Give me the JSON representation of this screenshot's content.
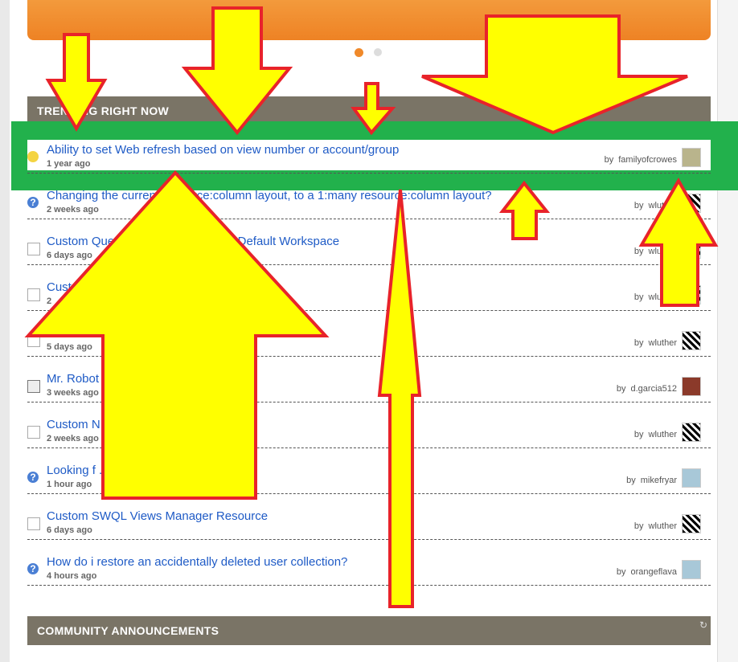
{
  "sections": {
    "trending_title": "TRENDING RIGHT NOW",
    "community_title": "COMMUNITY ANNOUNCEMENTS"
  },
  "colors": {
    "accent": "#f0892a",
    "bar": "#7a7466",
    "link": "#1f5bc6",
    "highlight": "#22b14c",
    "arrow": "#ffff00",
    "arrow_border": "#e8232a"
  },
  "threads": [
    {
      "title": "Ability to set Web refresh based on view number or account/group",
      "age": "1 year ago",
      "by": "by",
      "author": "familyofcrowes",
      "icon": "bulb-icon"
    },
    {
      "title": "Changing the current resource:column layout, to a 1:many resource:column layout?",
      "age": "2 weeks ago",
      "by": "by",
      "author": "wluther",
      "icon": "chat-icon"
    },
    {
      "title": "Custom Query Resource in Shared Default Workspace",
      "age": "6 days ago",
      "by": "by",
      "author": "wluther",
      "icon": "document-icon"
    },
    {
      "title": "Custom",
      "age": "2",
      "by": "by",
      "author": "wluther",
      "icon": "document-icon"
    },
    {
      "title": "",
      "age": "5 days ago",
      "by": "by",
      "author": "wluther",
      "icon": "document-icon"
    },
    {
      "title": "Mr. Robot ... ion Meets Reality",
      "age": "3 weeks ago",
      "by": "by",
      "author": "d.garcia512",
      "icon": "card-icon"
    },
    {
      "title": "Custom N ... Details Resource",
      "age": "2 weeks ago",
      "by": "by",
      "author": "wluther",
      "icon": "document-icon"
    },
    {
      "title": "Looking f ... ration check policy",
      "age": "1 hour ago",
      "by": "by",
      "author": "mikefryar",
      "icon": "chat-icon"
    },
    {
      "title": "Custom SWQL Views Manager Resource",
      "age": "6 days ago",
      "by": "by",
      "author": "wluther",
      "icon": "document-icon"
    },
    {
      "title": "How do i restore an accidentally deleted user collection?",
      "age": "4 hours ago",
      "by": "by",
      "author": "orangeflava",
      "icon": "chat-icon"
    }
  ]
}
